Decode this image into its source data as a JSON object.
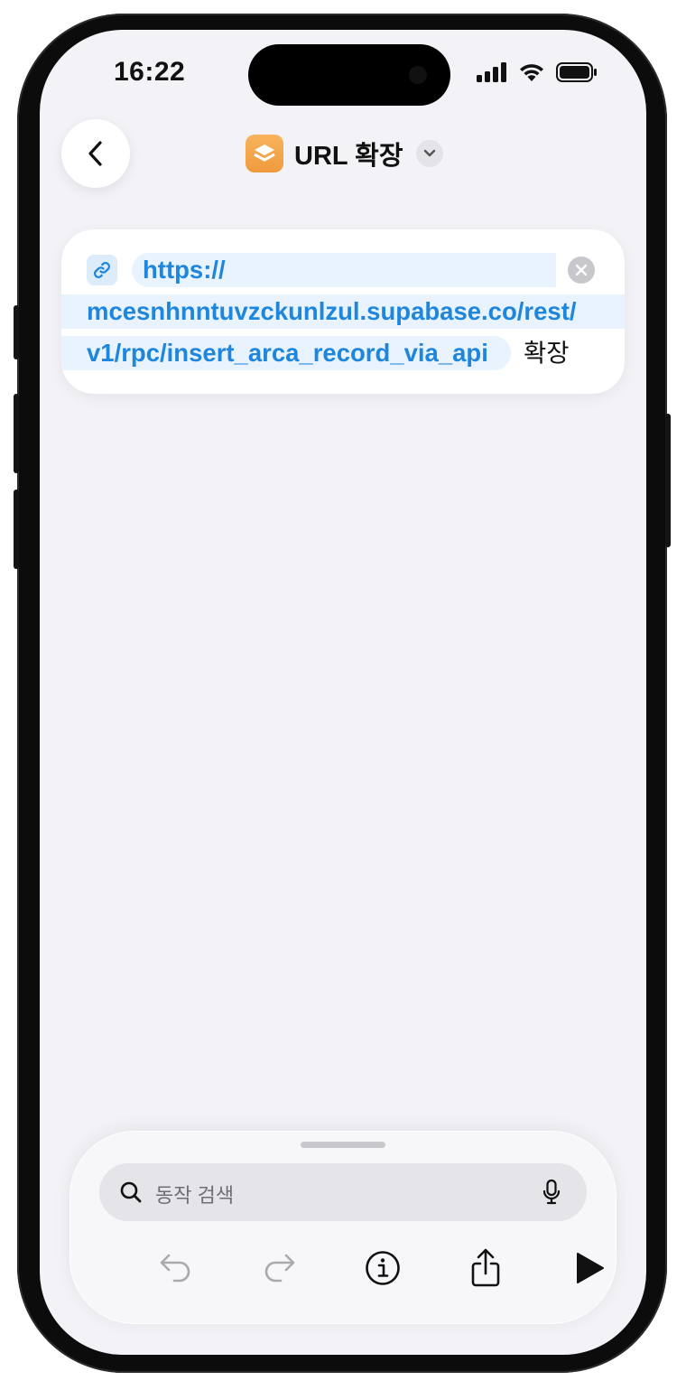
{
  "status_bar": {
    "time": "16:22"
  },
  "header": {
    "title": "URL 확장",
    "app_icon": "shortcuts-layers-icon",
    "accent": "#f4a24a"
  },
  "action": {
    "url_line1": "https://",
    "url_line2": "mcesnhnntuvzckunlzul.supabase.co/rest/",
    "url_line3": "v1/rpc/insert_arca_record_via_api",
    "action_word": "확장",
    "link_color": "#1e86dc"
  },
  "bottom_sheet": {
    "search_placeholder": "동작 검색",
    "toolbar": [
      "undo-icon",
      "redo-icon",
      "info-icon",
      "share-icon",
      "play-icon"
    ]
  }
}
